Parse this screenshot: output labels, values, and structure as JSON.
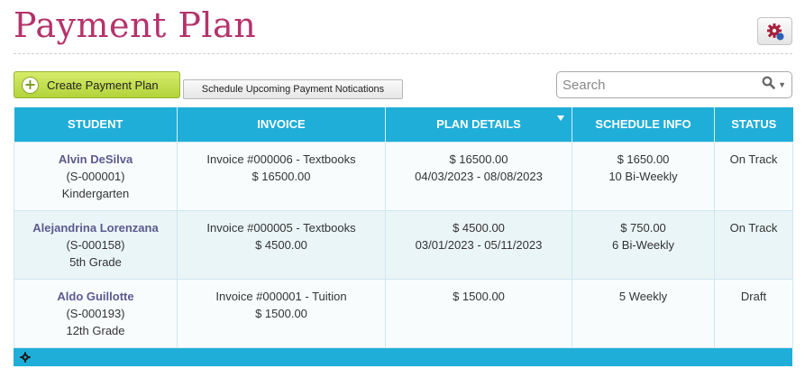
{
  "header": {
    "title": "Payment Plan"
  },
  "toolbar": {
    "create_label": "Create Payment Plan",
    "schedule_label": "Schedule Upcoming Payment Notications"
  },
  "search": {
    "placeholder": "Search",
    "value": ""
  },
  "table": {
    "columns": [
      "STUDENT",
      "INVOICE",
      "PLAN DETAILS",
      "SCHEDULE INFO",
      "STATUS"
    ],
    "rows": [
      {
        "student_name": "Alvin DeSilva",
        "student_id": "(S-000001)",
        "grade": "Kindergarten",
        "invoice_title": "Invoice #000006 - Textbooks",
        "invoice_amount": "$ 16500.00",
        "plan_amount": "$ 16500.00",
        "plan_dates": "04/03/2023 - 08/08/2023",
        "schedule_amount": "$ 1650.00",
        "schedule_freq": "10 Bi-Weekly",
        "status": "On Track"
      },
      {
        "student_name": "Alejandrina Lorenzana",
        "student_id": "(S-000158)",
        "grade": "5th Grade",
        "invoice_title": "Invoice #000005 - Textbooks",
        "invoice_amount": "$ 4500.00",
        "plan_amount": "$ 4500.00",
        "plan_dates": "03/01/2023 - 05/11/2023",
        "schedule_amount": "$ 750.00",
        "schedule_freq": "6 Bi-Weekly",
        "status": "On Track"
      },
      {
        "student_name": "Aldo Guillotte",
        "student_id": "(S-000193)",
        "grade": "12th Grade",
        "invoice_title": "Invoice #000001 - Tuition",
        "invoice_amount": "$ 1500.00",
        "plan_amount": "$ 1500.00",
        "plan_dates": "",
        "schedule_amount": "",
        "schedule_freq": "5 Weekly",
        "status": "Draft"
      }
    ]
  },
  "colors": {
    "title": "#b5336b",
    "header_bg": "#1faed8",
    "create_button": "#c4df4f",
    "student_link": "#5c5a8f"
  },
  "icons": {
    "settings": "gear-icon",
    "create": "plus-circle-icon",
    "search": "search-icon",
    "sort": "sort-down-icon",
    "footer": "gear-icon"
  }
}
